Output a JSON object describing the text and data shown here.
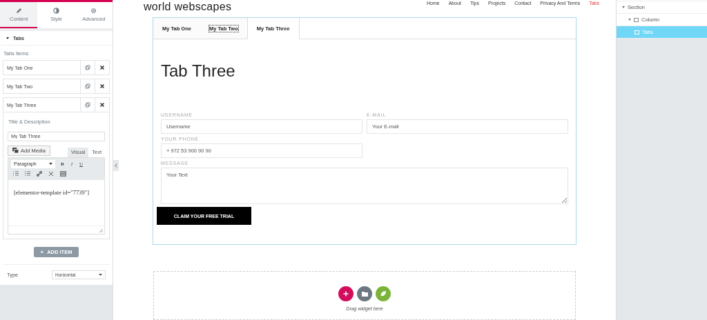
{
  "panel_tabs": [
    {
      "label": "Content",
      "selected": true
    },
    {
      "label": "Style",
      "selected": false
    },
    {
      "label": "Advanced",
      "selected": false
    }
  ],
  "section": {
    "title": "Tabs",
    "expanded": true
  },
  "items_label": "Tabs Items",
  "items": [
    {
      "title": "My Tab One",
      "expanded": false
    },
    {
      "title": "My Tab Two",
      "expanded": false
    },
    {
      "title": "My Tab Three",
      "expanded": true
    }
  ],
  "editor": {
    "title_label": "Title & Description",
    "title_value": "My Tab Three",
    "add_media": "Add Media",
    "modes": [
      {
        "label": "Visual",
        "selected": true
      },
      {
        "label": "Text",
        "selected": false
      }
    ],
    "format": "Paragraph",
    "format_buttons": [
      "B",
      "I",
      "U"
    ],
    "content": "[elementor-template id=\"7739\"]"
  },
  "add_item": {
    "icon": "+",
    "label": "ADD ITEM"
  },
  "type": {
    "label": "Type",
    "value": "Horizontal"
  },
  "site": {
    "logo": "world webscapes",
    "nav": [
      {
        "label": "Home",
        "selected": false
      },
      {
        "label": "About",
        "selected": false
      },
      {
        "label": "Tips",
        "selected": false
      },
      {
        "label": "Projects",
        "selected": false
      },
      {
        "label": "Contact",
        "selected": false
      },
      {
        "label": "Privacy And Terms",
        "selected": false
      },
      {
        "label": "Tabs",
        "selected": true
      }
    ]
  },
  "tabs": [
    {
      "label": "My Tab One",
      "selected": false,
      "focused": false
    },
    {
      "label": "My Tab Two",
      "selected": false,
      "focused": true
    },
    {
      "label": "My Tab Three",
      "selected": true,
      "focused": false
    }
  ],
  "heading": "Tab Three",
  "form": {
    "fields": [
      {
        "kind": "input",
        "label": "USERNAME",
        "placeholder": "Username"
      },
      {
        "kind": "input",
        "label": "E-MAIL",
        "placeholder": "Your E-mail"
      },
      {
        "kind": "input",
        "label": "YOUR PHONE",
        "placeholder": "+ 972 53 900 90 90"
      },
      {
        "kind": "textarea",
        "label": "MESSAGE",
        "placeholder": "Your Text"
      }
    ],
    "submit": "CLAIM YOUR FREE TRIAL"
  },
  "drop_zone": {
    "hint": "Drag widget here"
  },
  "navigator": [
    {
      "label": "Section",
      "selected": false,
      "expanded": true,
      "children": [
        {
          "label": "Column",
          "selected": false,
          "expanded": true,
          "children": [
            {
              "label": "Tabs",
              "selected": true
            }
          ]
        }
      ]
    }
  ]
}
